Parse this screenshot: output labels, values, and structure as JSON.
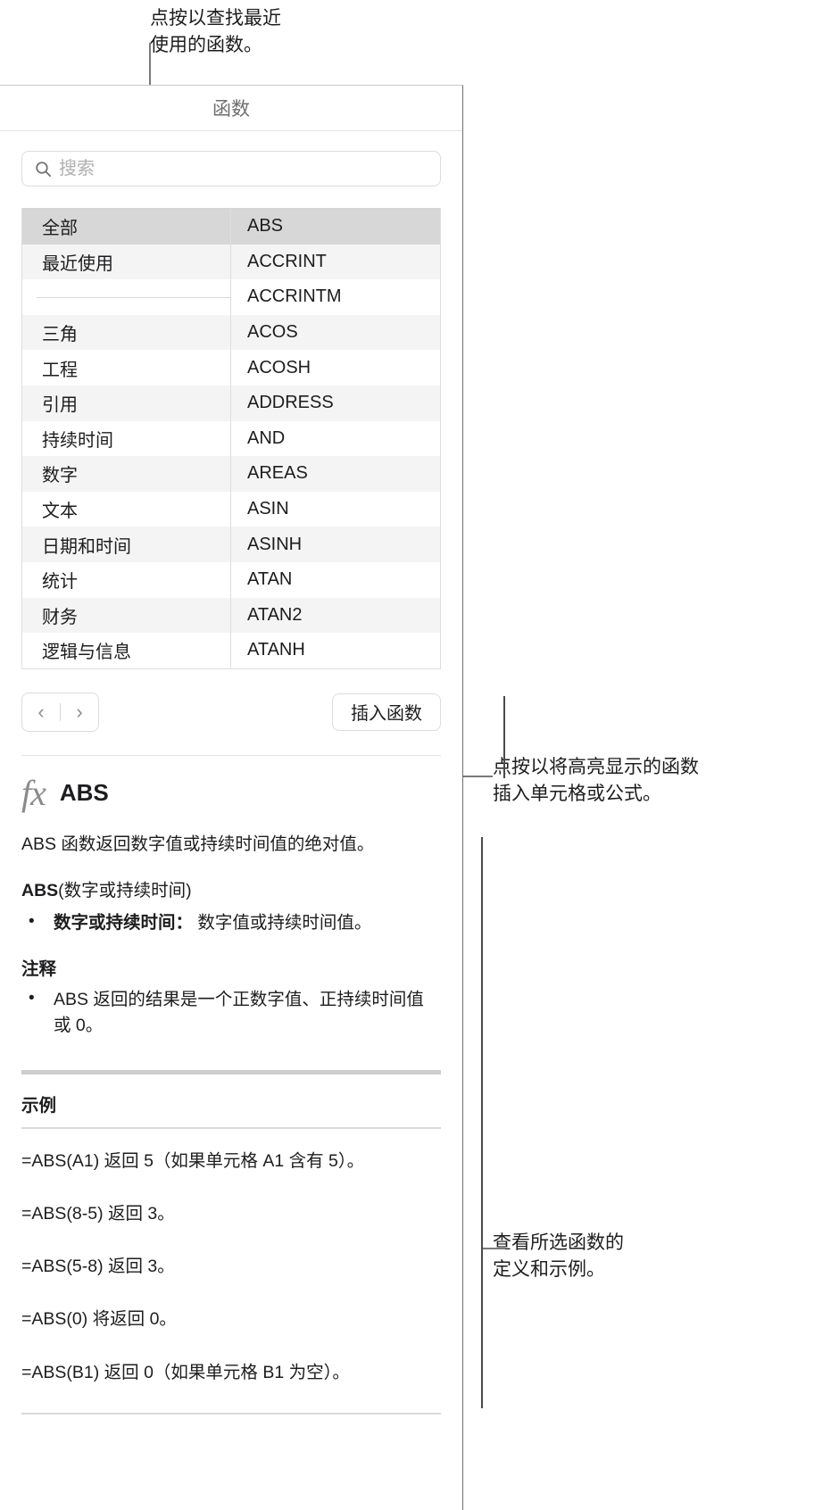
{
  "callouts": {
    "top": "点按以查找最近\n使用的函数。",
    "middle": "点按以将高亮显示的函数\n插入单元格或公式。",
    "bottom": "查看所选函数的\n定义和示例。"
  },
  "panel": {
    "title": "函数",
    "search": {
      "placeholder": "搜索",
      "value": "",
      "icon": "search-icon"
    },
    "categories": [
      {
        "label": "全部",
        "selected": true
      },
      {
        "label": "最近使用",
        "selected": false
      },
      {
        "label": "",
        "separator": true
      },
      {
        "label": "三角",
        "selected": false
      },
      {
        "label": "工程",
        "selected": false
      },
      {
        "label": "引用",
        "selected": false
      },
      {
        "label": "持续时间",
        "selected": false
      },
      {
        "label": "数字",
        "selected": false
      },
      {
        "label": "文本",
        "selected": false
      },
      {
        "label": "日期和时间",
        "selected": false
      },
      {
        "label": "统计",
        "selected": false
      },
      {
        "label": "财务",
        "selected": false
      },
      {
        "label": "逻辑与信息",
        "selected": false
      }
    ],
    "functions": [
      {
        "label": "ABS",
        "selected": true
      },
      {
        "label": "ACCRINT",
        "selected": false
      },
      {
        "label": "ACCRINTM",
        "selected": false
      },
      {
        "label": "ACOS",
        "selected": false
      },
      {
        "label": "ACOSH",
        "selected": false
      },
      {
        "label": "ADDRESS",
        "selected": false
      },
      {
        "label": "AND",
        "selected": false
      },
      {
        "label": "AREAS",
        "selected": false
      },
      {
        "label": "ASIN",
        "selected": false
      },
      {
        "label": "ASINH",
        "selected": false
      },
      {
        "label": "ATAN",
        "selected": false
      },
      {
        "label": "ATAN2",
        "selected": false
      },
      {
        "label": "ATANH",
        "selected": false
      }
    ],
    "toolbar": {
      "prev_label": "‹",
      "next_label": "›",
      "insert_label": "插入函数"
    }
  },
  "detail": {
    "fx_glyph": "fx",
    "function_name": "ABS",
    "description": "ABS 函数返回数字值或持续时间值的绝对值。",
    "signature_name": "ABS",
    "signature_args": "(数字或持续时间)",
    "arguments": [
      {
        "term": "数字或持续时间：",
        "text": " 数字值或持续时间值。"
      }
    ],
    "notes_heading": "注释",
    "notes": [
      "ABS 返回的结果是一个正数字值、正持续时间值或 0。"
    ],
    "examples_heading": "示例",
    "examples": [
      "=ABS(A1) 返回 5（如果单元格 A1 含有 5）。",
      "=ABS(8-5) 返回 3。",
      "=ABS(5-8) 返回 3。",
      "=ABS(0) 将返回 0。",
      "=ABS(B1) 返回 0（如果单元格 B1 为空）。"
    ]
  },
  "colors": {
    "selected_row": "#d7d7d7",
    "alt_row": "#f4f4f4",
    "leader_line": "#7a7a7a",
    "panel_border": "#6e6e6e"
  }
}
